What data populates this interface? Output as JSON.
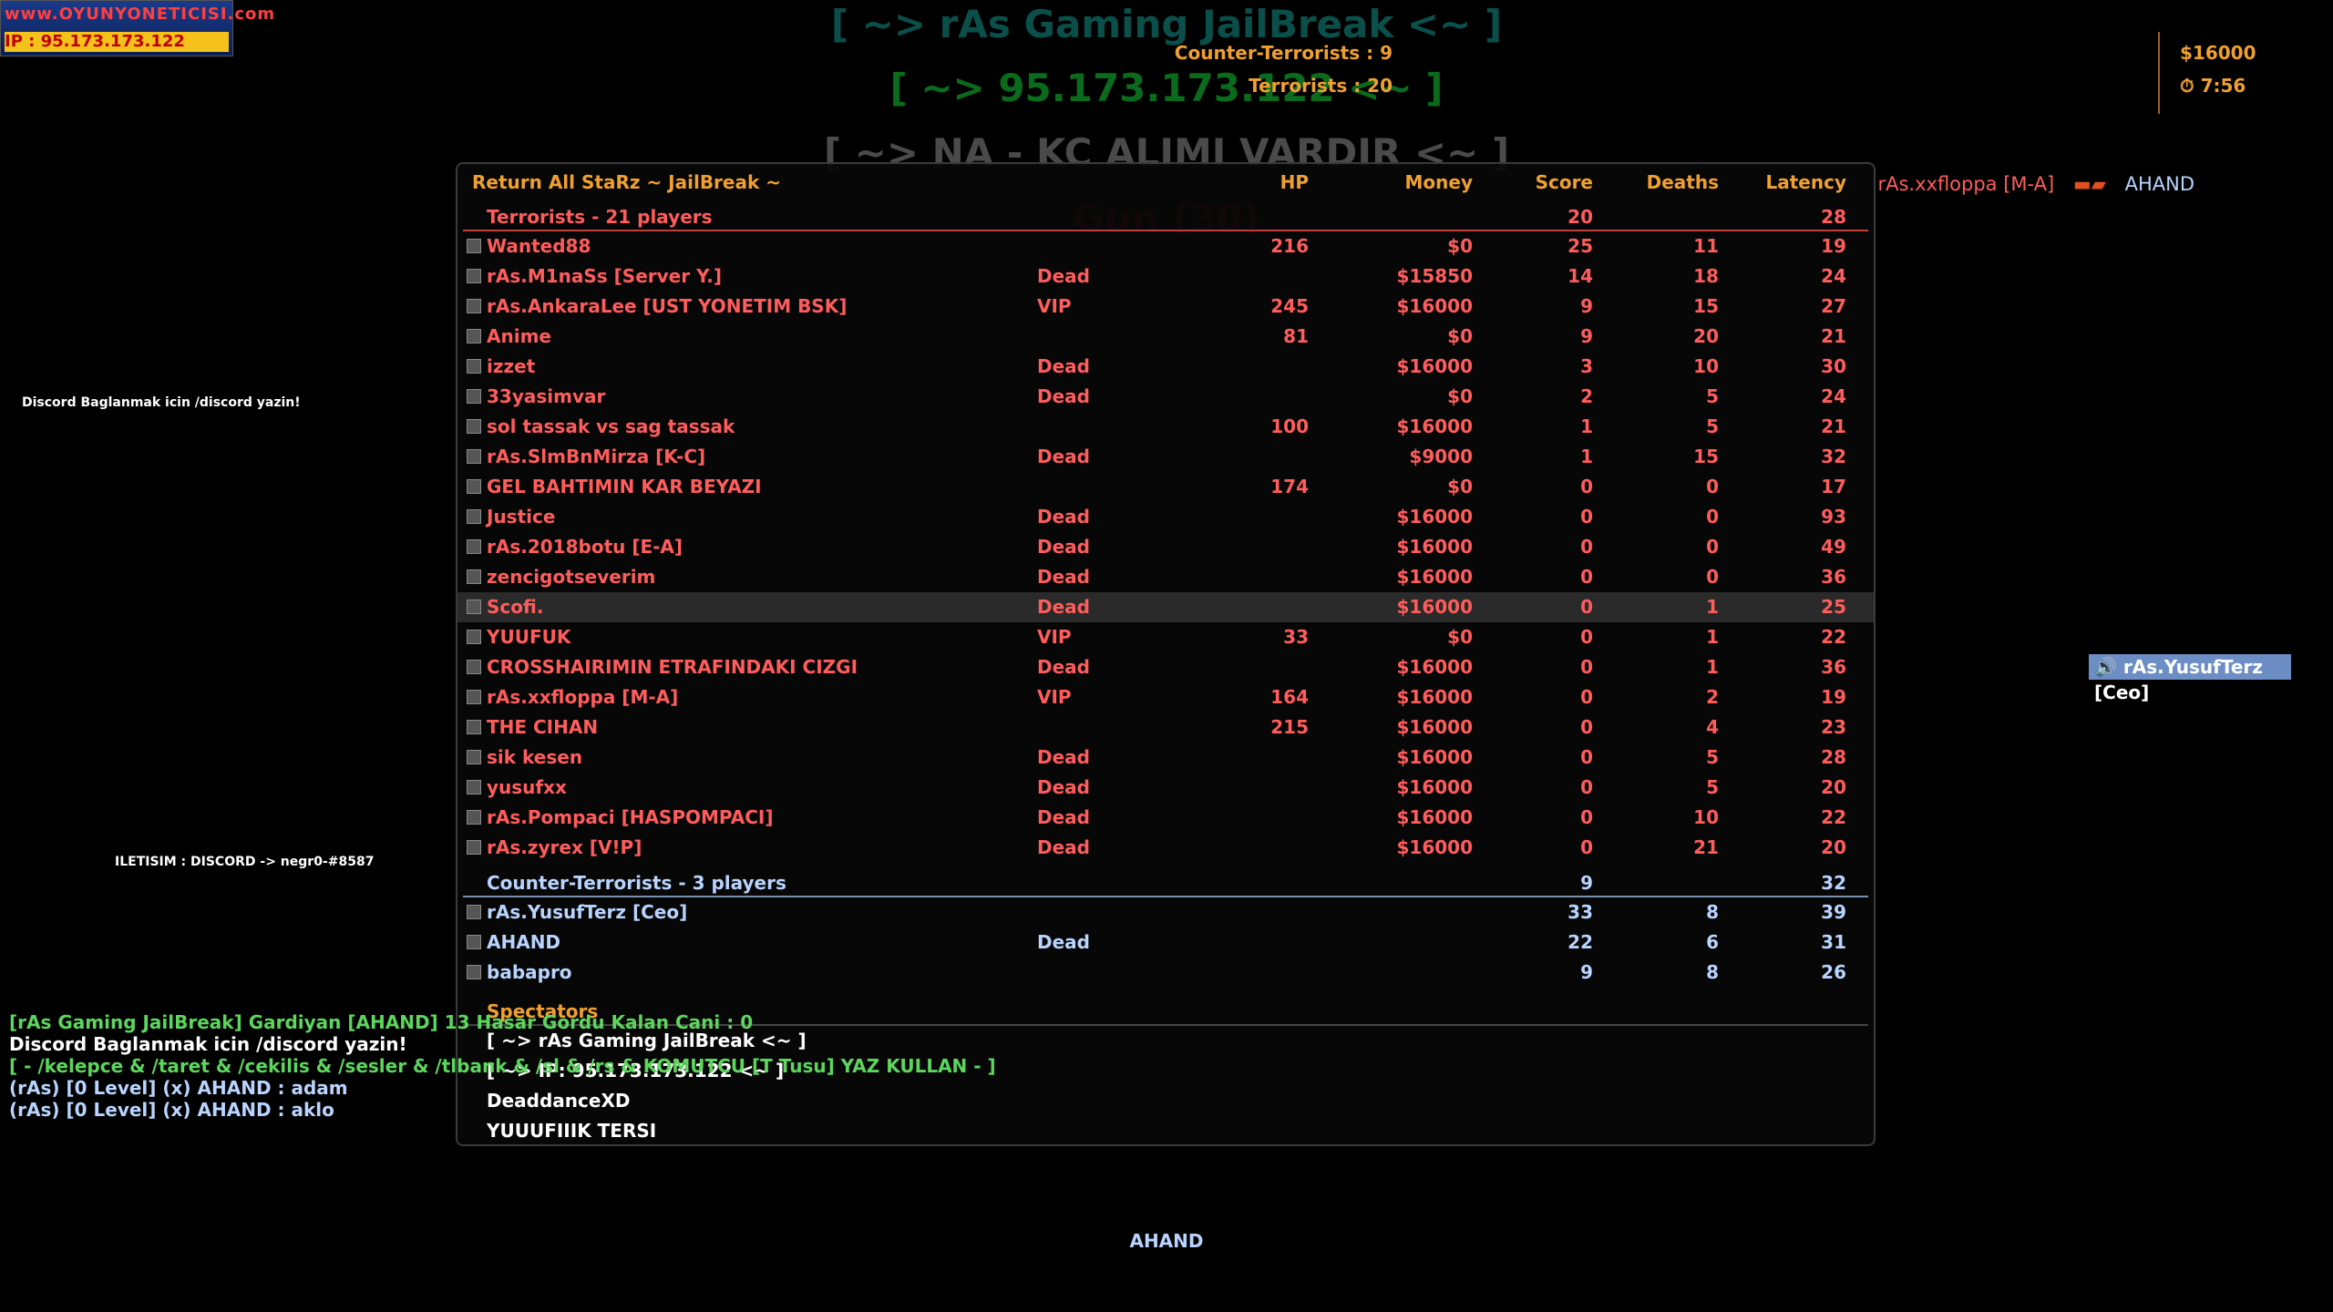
{
  "logo": {
    "line1": "www.OYUNYONETICISI.com",
    "line2": "IP : 95.173.173.122"
  },
  "hud_titles": [
    "[ ~> rAs Gaming JailBreak <~ ]",
    "[ ~> 95.173.173.122 <~ ]",
    "[ ~> NA - KC ALIMI VARDIR <~ ]",
    "Gun (30)"
  ],
  "team_score": {
    "ct_label": "Counter-Terrorists : 9",
    "t_label": "Terrorists : 20",
    "money": "$16000",
    "timer": "7:56"
  },
  "killfeed": {
    "killer": "rAs.xxfloppa [M-A]",
    "victim": "AHAND"
  },
  "left_messages": {
    "discord": "Discord Baglanmak icin /discord yazin!",
    "contact": "ILETISIM : DISCORD -> negr0-#8587"
  },
  "scoreboard": {
    "server_name": "Return All StaRz ~ JailBreak ~",
    "columns": {
      "hp": "HP",
      "money": "Money",
      "score": "Score",
      "deaths": "Deaths",
      "latency": "Latency"
    },
    "terrorists": {
      "title": "Terrorists    -    21 players",
      "score": "20",
      "latency": "28",
      "players": [
        {
          "name": "Wanted88",
          "status": "",
          "hp": "216",
          "money": "$0",
          "score": "25",
          "deaths": "11",
          "lat": "19"
        },
        {
          "name": "rAs.M1naSs [Server Y.]",
          "status": "Dead",
          "hp": "",
          "money": "$15850",
          "score": "14",
          "deaths": "18",
          "lat": "24"
        },
        {
          "name": "rAs.AnkaraLee [UST YONETIM BSK]",
          "status": "VIP",
          "hp": "245",
          "money": "$16000",
          "score": "9",
          "deaths": "15",
          "lat": "27"
        },
        {
          "name": "Anime",
          "status": "",
          "hp": "81",
          "money": "$0",
          "score": "9",
          "deaths": "20",
          "lat": "21"
        },
        {
          "name": "izzet",
          "status": "Dead",
          "hp": "",
          "money": "$16000",
          "score": "3",
          "deaths": "10",
          "lat": "30"
        },
        {
          "name": "33yasimvar",
          "status": "Dead",
          "hp": "",
          "money": "$0",
          "score": "2",
          "deaths": "5",
          "lat": "24"
        },
        {
          "name": "sol tassak vs sag tassak",
          "status": "",
          "hp": "100",
          "money": "$16000",
          "score": "1",
          "deaths": "5",
          "lat": "21"
        },
        {
          "name": "rAs.SlmBnMirza [K-C]",
          "status": "Dead",
          "hp": "",
          "money": "$9000",
          "score": "1",
          "deaths": "15",
          "lat": "32"
        },
        {
          "name": "GEL BAHTIMIN KAR BEYAZI",
          "status": "",
          "hp": "174",
          "money": "$0",
          "score": "0",
          "deaths": "0",
          "lat": "17"
        },
        {
          "name": "Justice",
          "status": "Dead",
          "hp": "",
          "money": "$16000",
          "score": "0",
          "deaths": "0",
          "lat": "93"
        },
        {
          "name": "rAs.2018botu [E-A]",
          "status": "Dead",
          "hp": "",
          "money": "$16000",
          "score": "0",
          "deaths": "0",
          "lat": "49"
        },
        {
          "name": "zencigotseverim",
          "status": "Dead",
          "hp": "",
          "money": "$16000",
          "score": "0",
          "deaths": "0",
          "lat": "36"
        },
        {
          "name": "Scofi.",
          "status": "Dead",
          "hp": "",
          "money": "$16000",
          "score": "0",
          "deaths": "1",
          "lat": "25"
        },
        {
          "name": "YUUFUK",
          "status": "VIP",
          "hp": "33",
          "money": "$0",
          "score": "0",
          "deaths": "1",
          "lat": "22"
        },
        {
          "name": "CROSSHAIRIMIN ETRAFINDAKI CIZGI",
          "status": "Dead",
          "hp": "",
          "money": "$16000",
          "score": "0",
          "deaths": "1",
          "lat": "36"
        },
        {
          "name": "rAs.xxfloppa [M-A]",
          "status": "VIP",
          "hp": "164",
          "money": "$16000",
          "score": "0",
          "deaths": "2",
          "lat": "19"
        },
        {
          "name": "THE CIHAN",
          "status": "",
          "hp": "215",
          "money": "$16000",
          "score": "0",
          "deaths": "4",
          "lat": "23"
        },
        {
          "name": "sik kesen",
          "status": "Dead",
          "hp": "",
          "money": "$16000",
          "score": "0",
          "deaths": "5",
          "lat": "28"
        },
        {
          "name": "yusufxx",
          "status": "Dead",
          "hp": "",
          "money": "$16000",
          "score": "0",
          "deaths": "5",
          "lat": "20"
        },
        {
          "name": "rAs.Pompaci [HASPOMPACI]",
          "status": "Dead",
          "hp": "",
          "money": "$16000",
          "score": "0",
          "deaths": "10",
          "lat": "22"
        },
        {
          "name": "rAs.zyrex [V!P]",
          "status": "Dead",
          "hp": "",
          "money": "$16000",
          "score": "0",
          "deaths": "21",
          "lat": "20"
        }
      ]
    },
    "counter_terrorists": {
      "title": "Counter-Terrorists    -    3 players",
      "score": "9",
      "latency": "32",
      "players": [
        {
          "name": "rAs.YusufTerz [Ceo]",
          "status": "",
          "hp": "",
          "money": "",
          "score": "33",
          "deaths": "8",
          "lat": "39"
        },
        {
          "name": "AHAND",
          "status": "Dead",
          "hp": "",
          "money": "",
          "score": "22",
          "deaths": "6",
          "lat": "31"
        },
        {
          "name": "babapro",
          "status": "",
          "hp": "",
          "money": "",
          "score": "9",
          "deaths": "8",
          "lat": "26"
        }
      ]
    },
    "spectators": {
      "title": "Spectators",
      "players": [
        "[ ~> rAs Gaming JailBreak <~ ]",
        "[ ~> IP: 95.173.173.122 <~ ]",
        "DeaddanceXD",
        "YUUUFIIIK TERSI"
      ]
    }
  },
  "chat": [
    "[rAs Gaming JailBreak] Gardiyan [AHAND] 13 Hasar Gordu Kalan Cani : 0",
    "Discord Baglanmak icin /discord yazin!",
    "[ - /kelepce & /taret & /cekilis & /sesler & /tlbank & /sl & /rs & KOMUTCU [T Tusu] YAZ KULLAN - ]",
    "(rAs) [0 Level] (x) AHAND : adam",
    "(rAs) [0 Level] (x) AHAND : aklo"
  ],
  "speaking": "rAs.YusufTerz [Ceo]",
  "bottom_name": "AHAND",
  "colors": {
    "terrorist": "#ff5c5c",
    "ct": "#b8d4ff",
    "header": "#f0a030"
  }
}
